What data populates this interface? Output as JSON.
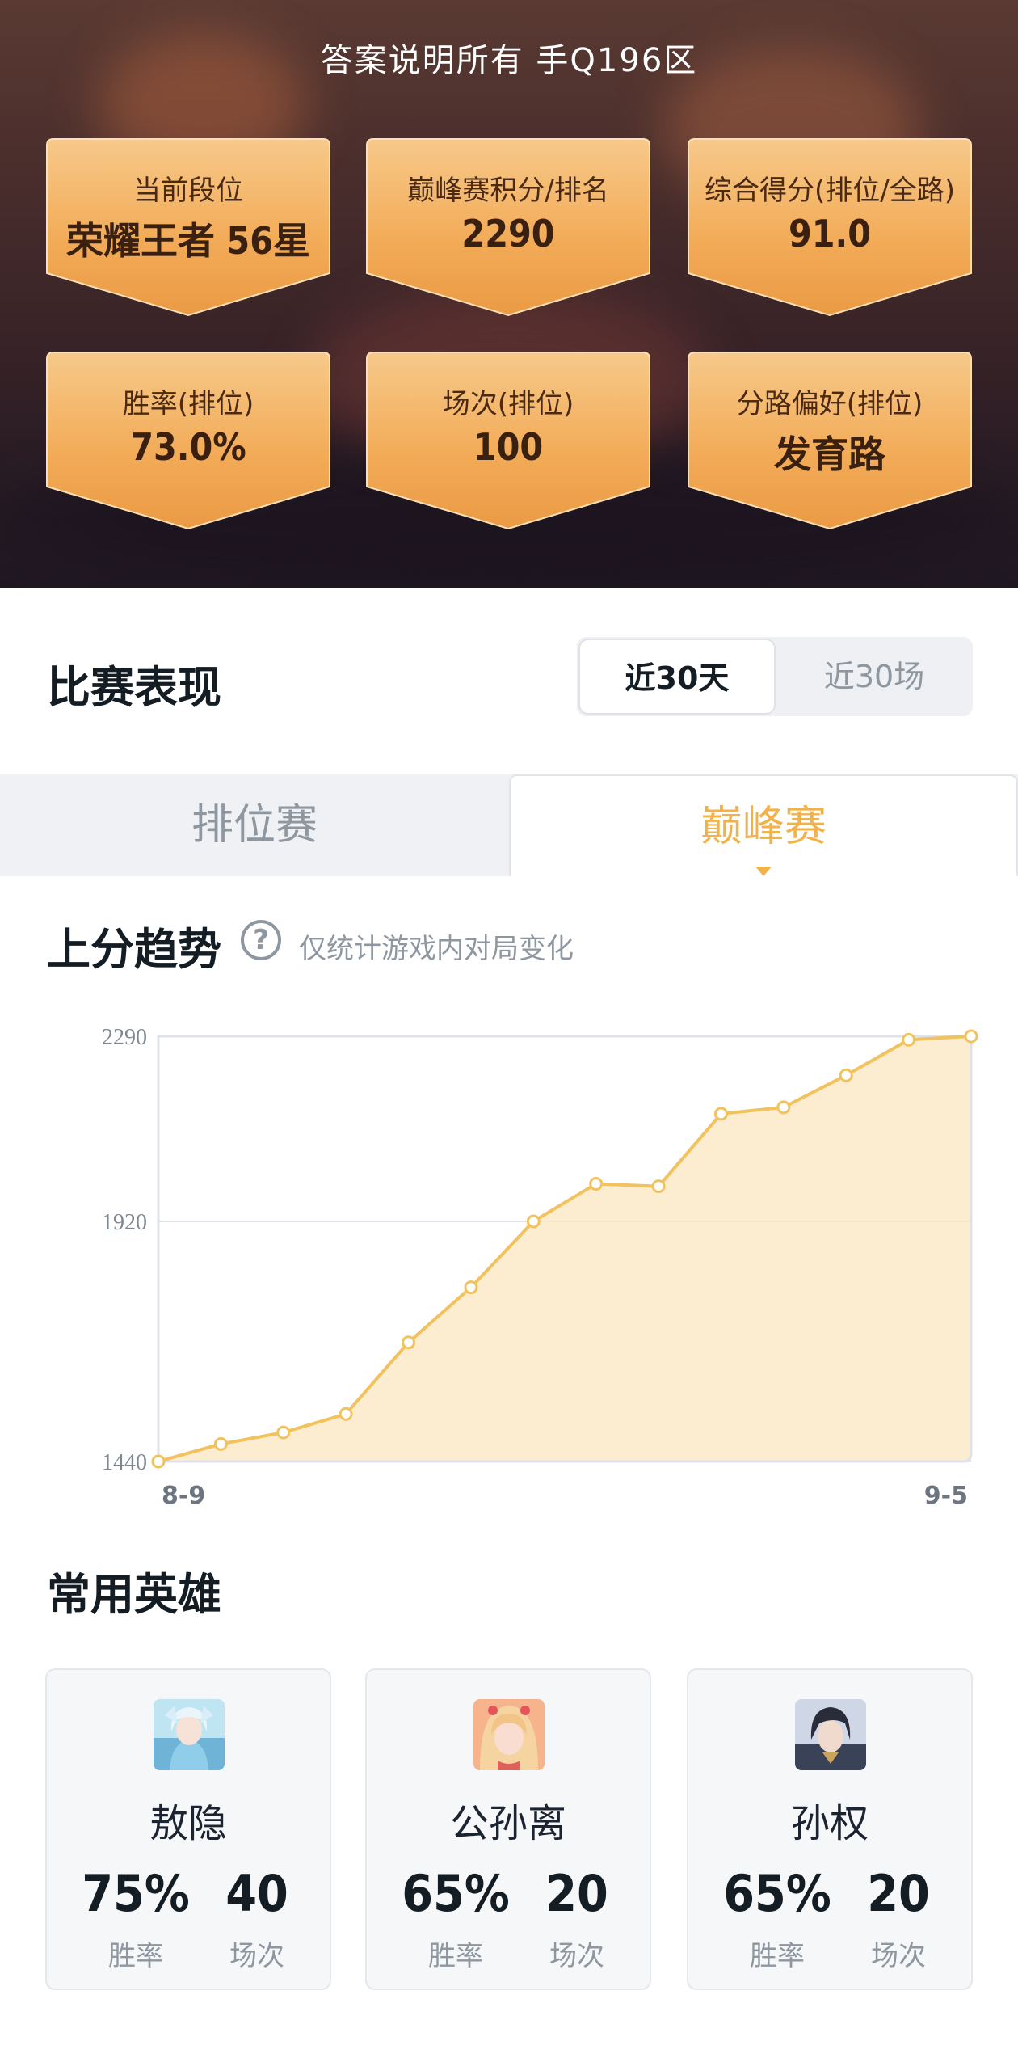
{
  "header": {
    "title": "答案说明所有  手Q196区"
  },
  "stats": [
    {
      "label": "当前段位",
      "value": "荣耀王者 56星"
    },
    {
      "label": "巅峰赛积分/排名",
      "value": "2290"
    },
    {
      "label": "综合得分(排位/全路)",
      "value": "91.0"
    },
    {
      "label": "胜率(排位)",
      "value": "73.0%"
    },
    {
      "label": "场次(排位)",
      "value": "100"
    },
    {
      "label": "分路偏好(排位)",
      "value": "发育路"
    }
  ],
  "performance": {
    "title": "比赛表现",
    "segments": [
      "近30天",
      "近30场"
    ],
    "selected_segment": "近30天"
  },
  "tabs": {
    "items": [
      "排位赛",
      "巅峰赛"
    ],
    "active": "巅峰赛"
  },
  "trend": {
    "title": "上分趋势",
    "help_icon": "question-circle-icon",
    "note": "仅统计游戏内对局变化"
  },
  "chart_data": {
    "type": "area",
    "x": [
      "8-9",
      "",
      "",
      "",
      "",
      "",
      "",
      "",
      "",
      "",
      "",
      "",
      "",
      "",
      "9-5"
    ],
    "xlabels": [
      "8-9",
      "9-5"
    ],
    "values": [
      1440,
      1475,
      1498,
      1535,
      1678,
      1788,
      1920,
      1995,
      1990,
      2135,
      2148,
      2212,
      2283,
      2290
    ],
    "yticks": [
      1440,
      1920,
      2290
    ],
    "ylim": [
      1440,
      2290
    ],
    "line_color": "#f1c25e",
    "fill_color": "#fde9c4",
    "grid": true
  },
  "heroes_section": {
    "title": "常用英雄",
    "win_label": "胜率",
    "games_label": "场次",
    "items": [
      {
        "name": "敖隐",
        "win_rate": "75%",
        "games": "40"
      },
      {
        "name": "公孙离",
        "win_rate": "65%",
        "games": "20"
      },
      {
        "name": "孙权",
        "win_rate": "65%",
        "games": "20"
      }
    ]
  },
  "colors": {
    "accent": "#f1b24a",
    "card_orange": "#f3b15d",
    "text_dark": "#141c24",
    "text_muted": "#8e96a0"
  }
}
